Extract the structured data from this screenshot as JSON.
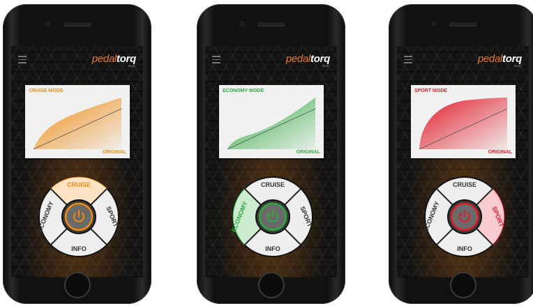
{
  "brand": {
    "name_light": "pedal",
    "name_bold": "torq",
    "suffix": "PLUS",
    "accent": "#e8782a"
  },
  "dial_labels": {
    "cruise": "CRUISE",
    "economy": "ECONOMY",
    "sport": "SPORT",
    "info": "INFO"
  },
  "phones": [
    {
      "mode_label": "CRUISE MODE",
      "original_label": "ORIGINAL",
      "active": "cruise",
      "color": "#f08c14"
    },
    {
      "mode_label": "ECONOMY MODE",
      "original_label": "ORIGINAL",
      "active": "economy",
      "color": "#2eaa3c"
    },
    {
      "mode_label": "SPORT MODE",
      "original_label": "ORIGINAL",
      "active": "sport",
      "color": "#e11d2a"
    }
  ]
}
